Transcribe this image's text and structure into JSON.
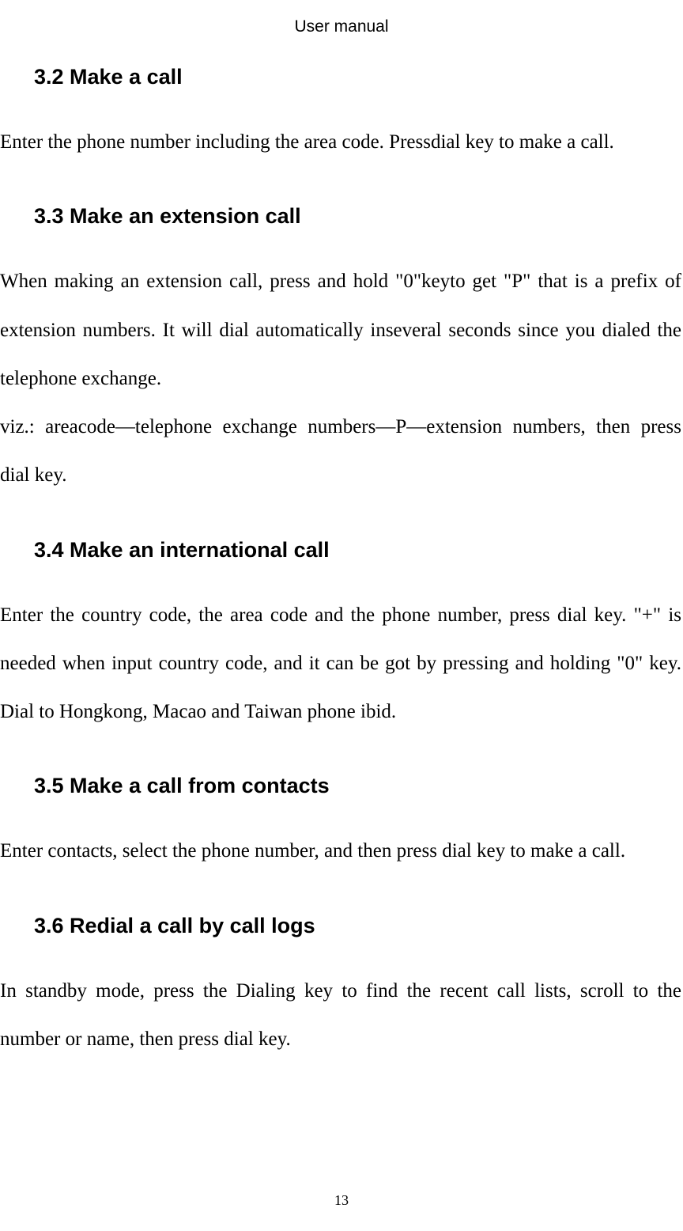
{
  "header": "User manual",
  "sections": [
    {
      "heading": "3.2 Make a call",
      "body": "Enter the phone number including the area code. Pressdial key to make a call."
    },
    {
      "heading": "3.3 Make an extension call",
      "body": "When making an extension call, press and hold \"0\"keyto get \"P\" that is a prefix of extension numbers. It will dial automatically inseveral seconds since you dialed the telephone exchange.",
      "body2": "viz.: areacode—telephone exchange numbers—P—extension numbers, then press dial key."
    },
    {
      "heading": "3.4 Make an international call",
      "body": "Enter the country code, the area code and the phone number, press dial key. \"+\" is needed when input country code, and it can be got by pressing and holding \"0\" key. Dial to Hongkong, Macao and Taiwan phone ibid."
    },
    {
      "heading": "3.5 Make a call from contacts",
      "body": "Enter contacts, select the phone number, and then press dial key to make a call."
    },
    {
      "heading": "3.6 Redial a call by call logs",
      "body": "In standby mode, press the Dialing key to find the recent call lists, scroll to the number or name, then press dial key."
    }
  ],
  "pageNumber": "13"
}
